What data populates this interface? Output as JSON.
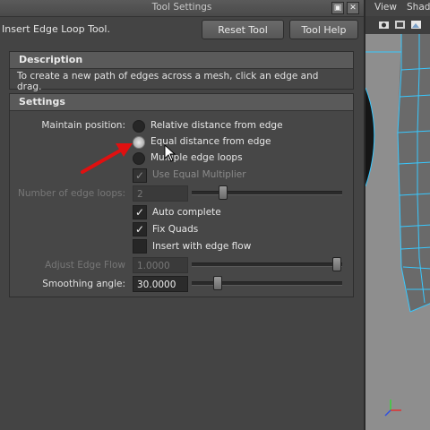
{
  "window": {
    "title": "Tool Settings",
    "tool_name": "Insert Edge Loop Tool.",
    "reset_label": "Reset Tool",
    "help_label": "Tool Help"
  },
  "description": {
    "header": "Description",
    "text": "To create a new path of edges across a mesh, click an edge and drag."
  },
  "settings": {
    "header": "Settings",
    "maintain_position": {
      "label": "Maintain position:",
      "options": [
        {
          "label": "Relative distance from edge",
          "selected": false
        },
        {
          "label": "Equal distance from edge",
          "selected": true
        },
        {
          "label": "Multiple edge loops",
          "selected": false
        }
      ]
    },
    "use_equal_multiplier": {
      "label": "Use Equal Multiplier",
      "checked": true,
      "enabled": false
    },
    "number_of_edge_loops": {
      "label": "Number of edge loops:",
      "value": "2",
      "enabled": false
    },
    "auto_complete": {
      "label": "Auto complete",
      "checked": true
    },
    "fix_quads": {
      "label": "Fix Quads",
      "checked": true
    },
    "insert_with_edge_flow": {
      "label": "Insert with edge flow",
      "checked": false
    },
    "adjust_edge_flow": {
      "label": "Adjust Edge Flow",
      "value": "1.0000",
      "enabled": false
    },
    "smoothing_angle": {
      "label": "Smoothing angle:",
      "value": "30.0000"
    }
  },
  "viewport": {
    "menus": [
      "View",
      "Shadi"
    ],
    "bg_color": "#8e8e8e",
    "wire_color": "#38c8ff"
  },
  "annotation_arrow_color": "#e01010"
}
